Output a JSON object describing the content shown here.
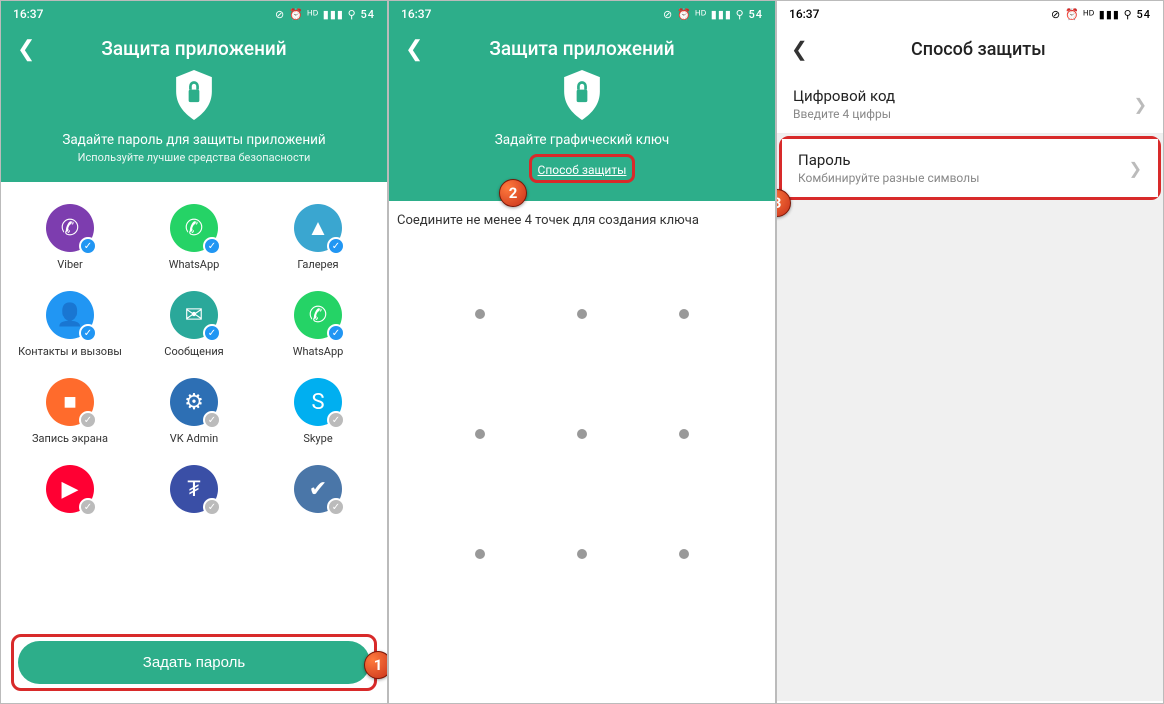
{
  "status": {
    "time": "16:37",
    "battery": "54"
  },
  "panel1": {
    "title": "Защита приложений",
    "sub1": "Задайте пароль для защиты приложений",
    "sub2": "Используйте лучшие средства безопасности",
    "apps": [
      {
        "name": "Viber",
        "color": "#7d3daf",
        "glyph": "✆",
        "checked": true
      },
      {
        "name": "WhatsApp",
        "color": "#25d366",
        "glyph": "✆",
        "checked": true
      },
      {
        "name": "Галерея",
        "color": "#3aa6d0",
        "glyph": "▲",
        "checked": true
      },
      {
        "name": "Контакты и вызовы",
        "color": "#2196f3",
        "glyph": "👤",
        "checked": true
      },
      {
        "name": "Сообщения",
        "color": "#2aa89a",
        "glyph": "✉",
        "checked": true
      },
      {
        "name": "WhatsApp",
        "color": "#25d366",
        "glyph": "✆",
        "checked": true
      },
      {
        "name": "Запись экрана",
        "color": "#ff6b2c",
        "glyph": "■",
        "checked": false
      },
      {
        "name": "VK Admin",
        "color": "#2d6fb4",
        "glyph": "⚙",
        "checked": false
      },
      {
        "name": "Skype",
        "color": "#00aff0",
        "glyph": "S",
        "checked": false
      },
      {
        "name": "",
        "color": "#ff0033",
        "glyph": "▶",
        "checked": false
      },
      {
        "name": "",
        "color": "#3a4fa6",
        "glyph": "₮",
        "checked": false
      },
      {
        "name": "",
        "color": "#4a76a8",
        "glyph": "✔",
        "checked": false
      }
    ],
    "button": "Задать пароль",
    "step": "1"
  },
  "panel2": {
    "title": "Защита приложений",
    "sub1": "Задайте графический ключ",
    "link": "Способ защиты",
    "instr": "Соедините не менее 4 точек для создания ключа",
    "step": "2"
  },
  "panel3": {
    "title": "Способ защиты",
    "items": [
      {
        "title": "Цифровой код",
        "sub": "Введите 4 цифры"
      },
      {
        "title": "Пароль",
        "sub": "Комбинируйте разные символы"
      }
    ],
    "step": "3"
  }
}
